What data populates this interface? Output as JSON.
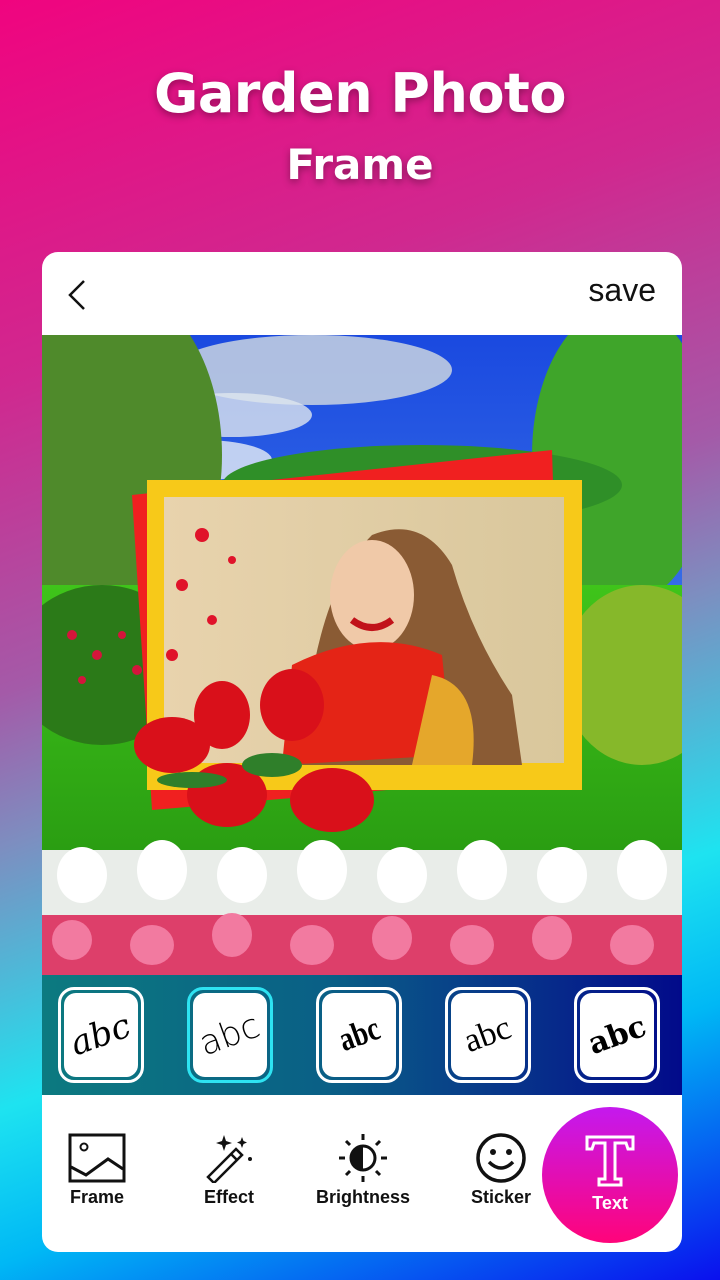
{
  "header": {
    "title_line1": "Garden Photo",
    "title_line2": "Frame"
  },
  "topbar": {
    "back_icon": "chevron-left-icon",
    "save_label": "save"
  },
  "photo": {
    "description": "Garden scene with woman portrait inside red and yellow decorative frame with red tulips"
  },
  "font_styles": [
    {
      "label": "abc",
      "style": "serif-italic",
      "selected": false
    },
    {
      "label": "abc",
      "style": "sans-light",
      "selected": true
    },
    {
      "label": "abc",
      "style": "condensed-bold",
      "selected": false
    },
    {
      "label": "abc",
      "style": "serif-light",
      "selected": false
    },
    {
      "label": "abc",
      "style": "blackletter-bold",
      "selected": false
    }
  ],
  "tools": [
    {
      "label": "Frame",
      "icon": "image-icon",
      "active": false
    },
    {
      "label": "Effect",
      "icon": "magic-wand-icon",
      "active": false
    },
    {
      "label": "Brightness",
      "icon": "brightness-icon",
      "active": false
    },
    {
      "label": "Sticker",
      "icon": "smiley-icon",
      "active": false
    },
    {
      "label": "Text",
      "icon": "text-t-icon",
      "active": true
    }
  ],
  "colors": {
    "accent_gradient_top": "#c419ee",
    "accent_gradient_bottom": "#ff047a",
    "selected_tile_border": "#2ee3f2"
  }
}
